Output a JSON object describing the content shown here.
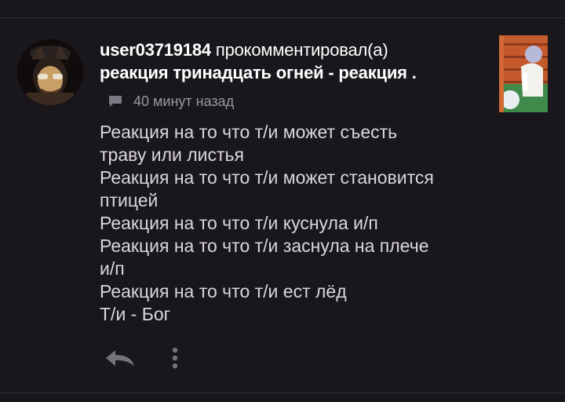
{
  "comment_card": {
    "username": "user03719184",
    "action": "прокомментировал(а)",
    "post_title": "реакция тринадцать огней - реакция .",
    "timestamp": "40 минут назад",
    "body": "Реакция на то что т/и может съесть\nтраву или листья\nРеакция на то что т/и может становится\nптицей\nРеакция на то что т/и куснула и/п\nРеакция на то что т/и заснула на плече\nи/п\nРеакция на то что т/и ест лёд\nТ/и - Бог",
    "icons": {
      "timestamp": "chat-bubble-icon",
      "reply": "reply-arrow-icon",
      "more": "more-vertical-icon"
    }
  },
  "colors": {
    "background": "#1a171c",
    "text_primary": "#ffffff",
    "text_body": "#d9d6dc",
    "text_muted": "#9a969e"
  }
}
